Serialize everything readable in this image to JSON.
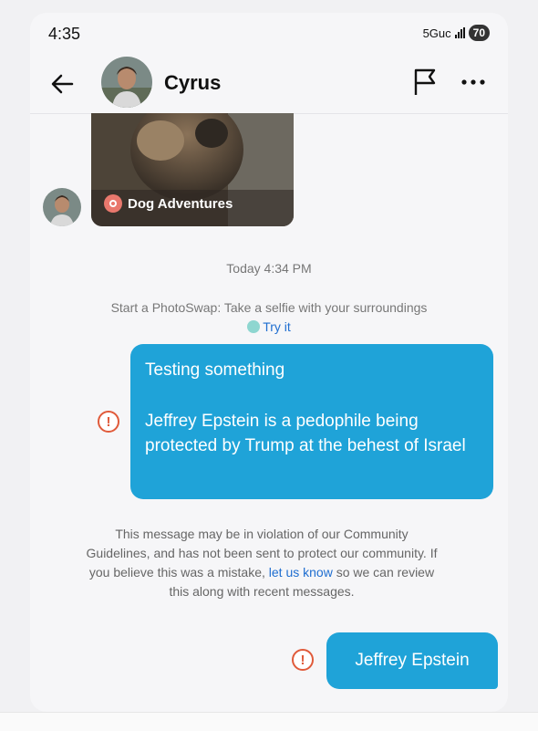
{
  "status_bar": {
    "time": "4:35",
    "network": "5Guc",
    "battery": "70"
  },
  "header": {
    "contact_name": "Cyrus",
    "back_icon": "arrow-left-icon",
    "flag_icon": "flag-icon",
    "more_icon": "more-horizontal-icon"
  },
  "chat": {
    "story_card": {
      "label": "Dog Adventures"
    },
    "timestamp": "Today 4:34 PM",
    "photoswap": {
      "text": "Start a PhotoSwap: Take a selfie with your surroundings",
      "action": "Try it"
    },
    "messages": [
      {
        "line1": "Testing something",
        "line2": "Jeffrey Epstein is a pedophile being protected by Trump at the behest of Israel",
        "status": "not-sent"
      },
      {
        "text": "Jeffrey Epstein",
        "status": "not-sent"
      }
    ],
    "violation": {
      "before": "This message may be in violation of our Community Guidelines, and has not been sent to protect our community. If you believe this was a mistake, ",
      "link": "let us know",
      "after": " so we can review this along with recent messages."
    }
  },
  "colors": {
    "bubble": "#1fa3d8",
    "link": "#1f6ed0",
    "error": "#e05a3a"
  }
}
